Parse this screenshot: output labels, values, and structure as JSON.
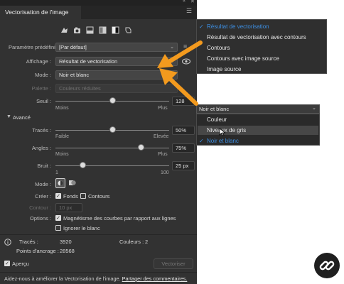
{
  "panel": {
    "title": "Vectorisation de l'image",
    "preset": {
      "label": "Paramètre prédéfini :",
      "value": "[Par défaut]"
    },
    "view": {
      "label": "Affichage :",
      "value": "Résultat de vectorisation"
    },
    "mode": {
      "label": "Mode :",
      "value": "Noir et blanc"
    },
    "palette": {
      "label": "Palette :",
      "value": "Couleurs réduites"
    },
    "threshold": {
      "label": "Seuil :",
      "value": "128",
      "min_label": "Moins",
      "max_label": "Plus",
      "level": 0.5
    },
    "advanced": {
      "label": "Avancé"
    },
    "paths": {
      "label": "Tracés :",
      "value": "50%",
      "min_label": "Faible",
      "max_label": "Elevée",
      "level": 0.5
    },
    "corners": {
      "label": "Angles :",
      "value": "75%",
      "min_label": "Moins",
      "max_label": "Plus",
      "level": 0.75
    },
    "noise": {
      "label": "Bruit :",
      "value": "25 px",
      "min_label": "1",
      "max_label": "100",
      "level": 0.24
    },
    "method": {
      "label": "Mode :"
    },
    "create": {
      "label": "Créer :",
      "fills": "Fonds",
      "strokes": "Contours"
    },
    "stroke": {
      "label": "Contour :",
      "value": "10 px"
    },
    "options": {
      "label": "Options :",
      "snap": "Magnétisme des courbes par rapport aux lignes",
      "ignore_white": "Ignorer le blanc"
    },
    "stats": {
      "paths_label": "Tracés :",
      "paths_value": "3920",
      "colors_label": "Couleurs :",
      "colors_value": "2",
      "anchors_label": "Points d'ancrage :",
      "anchors_value": "28568"
    },
    "preview": "Aperçu",
    "vectorize": "Vectoriser",
    "footer_text": "Aidez-nous à améliorer la Vectorisation de l'image.",
    "footer_link": "Partager des commentaires."
  },
  "view_menu": {
    "items": [
      "Résultat de vectorisation",
      "Résultat de vectorisation avec contours",
      "Contours",
      "Contours avec image source",
      "Image source"
    ],
    "selected": "Résultat de vectorisation"
  },
  "mode_dropdown": {
    "value": "Noir et blanc",
    "items": [
      "Couleur",
      "Niveaux de gris",
      "Noir et blanc"
    ],
    "selected": "Noir et blanc"
  },
  "colors": {
    "accent": "#3d8fe3",
    "arrow": "#f39a1e",
    "panel_bg": "#323232"
  },
  "icons": [
    "auto-color-icon",
    "high-color-icon",
    "low-color-icon",
    "grayscale-icon",
    "black-white-icon",
    "outline-icon",
    "info-icon",
    "link-logo-icon"
  ]
}
